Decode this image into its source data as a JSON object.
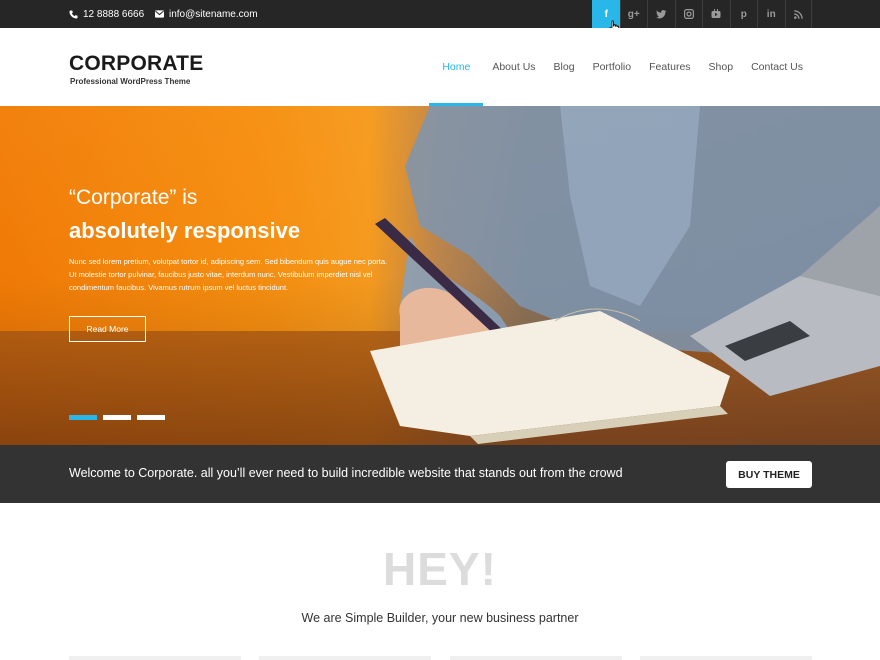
{
  "topbar": {
    "phone": "12 8888 6666",
    "email": "info@sitename.com",
    "social": [
      {
        "icon": "facebook-icon",
        "glyph": "f",
        "active": true
      },
      {
        "icon": "google-plus-icon",
        "glyph": "g+",
        "active": false
      },
      {
        "icon": "twitter-icon",
        "glyph": "",
        "active": false
      },
      {
        "icon": "instagram-icon",
        "glyph": "",
        "active": false
      },
      {
        "icon": "youtube-icon",
        "glyph": "",
        "active": false
      },
      {
        "icon": "pinterest-icon",
        "glyph": "p",
        "active": false
      },
      {
        "icon": "linkedin-icon",
        "glyph": "in",
        "active": false
      },
      {
        "icon": "rss-icon",
        "glyph": "",
        "active": false
      }
    ]
  },
  "header": {
    "logo": "CORPORATE",
    "tagline": "Professional WordPress Theme",
    "nav": [
      "Home",
      "About Us",
      "Blog",
      "Portfolio",
      "Features",
      "Shop",
      "Contact Us"
    ],
    "active_nav": "Home"
  },
  "hero": {
    "title_line1": "“Corporate” is",
    "title_line2": "absolutely responsive",
    "body": "Nunc sed lorem pretium, volutpat tortor id, adipiscing sem. Sed bibendum quis augue nec porta. Ut molestie tortor pulvinar, faucibus justo vitae, interdum nunc. Vestibulum imperdiet nisl vel condimentum faucibus. Vivamus rutrum ipsum vel luctus tincidunt.",
    "button": "Read More",
    "slides": 3,
    "active_slide": 1
  },
  "cta": {
    "text": "Welcome to Corporate. all you’ll ever need to build incredible website that stands out from the crowd",
    "button": "BUY THEME"
  },
  "intro": {
    "heading": "HEY!",
    "subheading": "We are Simple Builder, your new business partner"
  },
  "colors": {
    "accent": "#29b6e8",
    "topbar_bg": "#262626",
    "cta_bg": "#333333",
    "hero_orange": "#f58e10"
  }
}
